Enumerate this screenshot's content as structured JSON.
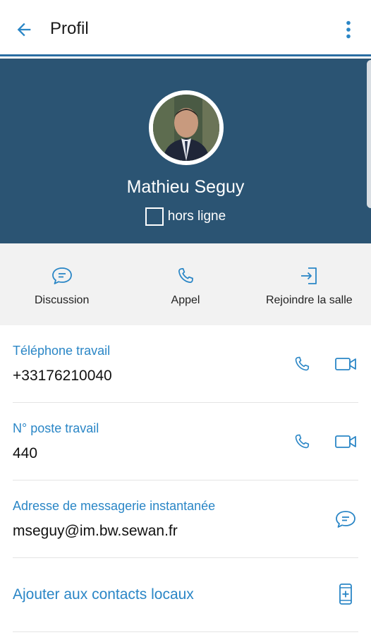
{
  "header": {
    "title": "Profil",
    "back_icon": "arrow-left-icon",
    "menu_icon": "more-vertical-icon"
  },
  "profile": {
    "name": "Mathieu Seguy",
    "status_label": "hors ligne",
    "status_checked": false
  },
  "actions": [
    {
      "label": "Discussion",
      "icon": "chat-icon"
    },
    {
      "label": "Appel",
      "icon": "phone-icon"
    },
    {
      "label": "Rejoindre la salle",
      "icon": "join-room-icon"
    }
  ],
  "details": {
    "work_phone": {
      "label": "Téléphone travail",
      "value": "+33176210040"
    },
    "work_extension": {
      "label": "N° poste travail",
      "value": "440"
    },
    "im_address": {
      "label": "Adresse de messagerie instantanée",
      "value": "mseguy@im.bw.sewan.fr"
    },
    "add_contact": {
      "label": "Ajouter aux contacts locaux"
    }
  },
  "colors": {
    "accent": "#2a86c6",
    "hero_background": "#2b5473",
    "actions_background": "#f2f2f2"
  }
}
